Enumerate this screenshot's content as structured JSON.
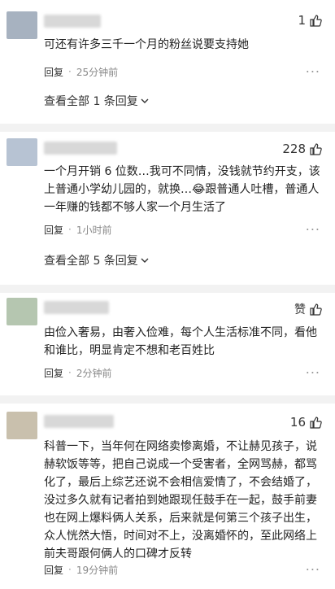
{
  "comments": [
    {
      "avatar_color": "#a7b2c0",
      "likes": "1",
      "text": "可还有许多三千一个月的粉丝说要支持她",
      "reply_label": "回复",
      "time": "25分钟前",
      "view_all": "查看全部 1 条回复"
    },
    {
      "avatar_color": "#b7c3d3",
      "likes": "228",
      "text": "一个月开销 6 位数…我可不同情，没钱就节约开支，该上普通小学幼儿园的，就换…😂跟普通人吐槽，普通人一年赚的钱都不够人家一个月生活了",
      "reply_label": "回复",
      "time": "1小时前",
      "view_all": "查看全部 5 条回复"
    },
    {
      "avatar_color": "#b5c6b0",
      "likes": "赞",
      "text": "由俭入奢易，由奢入俭难，每个人生活标准不同，看他和谁比，明显肯定不想和老百姓比",
      "reply_label": "回复",
      "time": "2分钟前"
    },
    {
      "avatar_color": "#c9c0ad",
      "likes": "16",
      "text": "科普一下，当年何在网络卖惨离婚，不让赫见孩子，说赫软饭等等，把自己说成一个受害者，全网骂赫，都骂化了，最后上综艺还说不会相信爱情了，不会结婚了，没过多久就有记者拍到她跟现任鼓手在一起，鼓手前妻也在网上爆料俩人关系，后来就是何第三个孩子出生，众人恍然大悟，时间对不上，没离婚怀的，至此网络上前夫哥跟何俩人的口碑才反转",
      "reply_label": "回复",
      "time": "19分钟前"
    }
  ],
  "more_icon": "···"
}
